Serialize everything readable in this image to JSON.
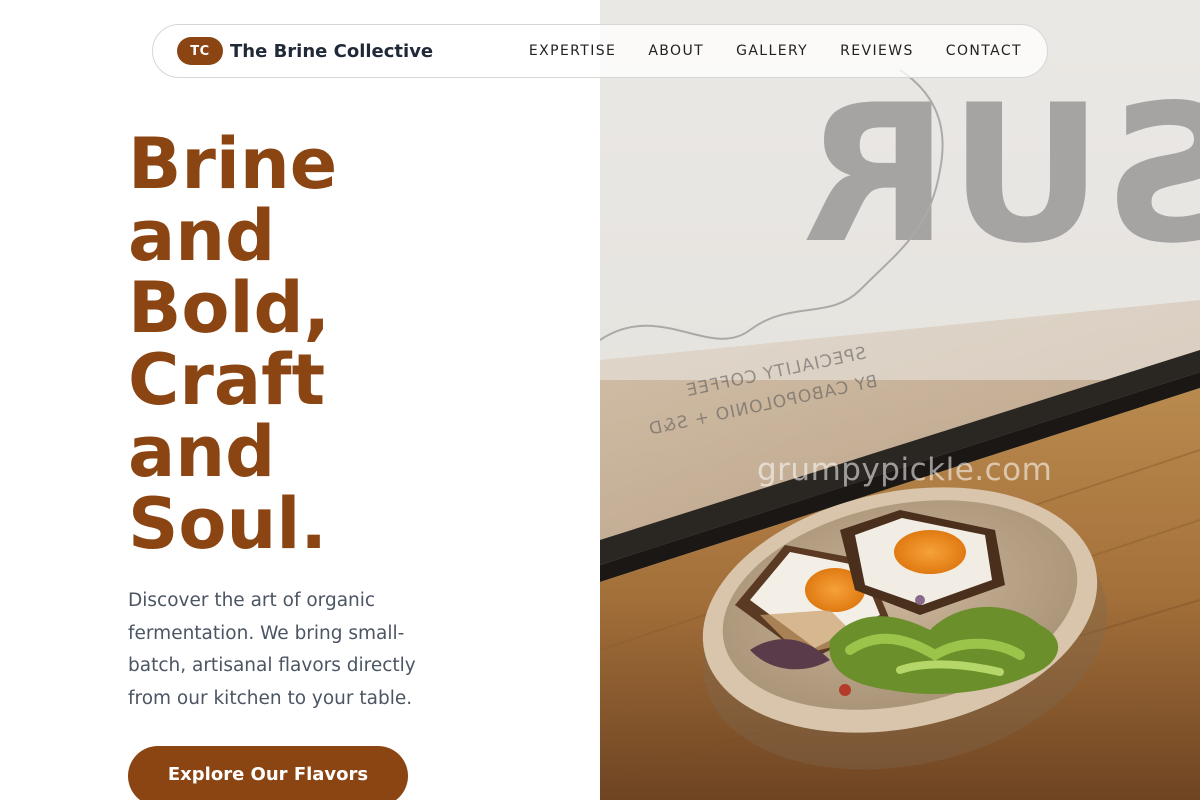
{
  "brand": {
    "initials": "TC",
    "name": "The Brine Collective"
  },
  "nav": {
    "links": [
      {
        "label": "EXPERTISE"
      },
      {
        "label": "ABOUT"
      },
      {
        "label": "GALLERY"
      },
      {
        "label": "REVIEWS"
      },
      {
        "label": "CONTACT"
      }
    ]
  },
  "hero": {
    "title_lines": [
      "Brine",
      "and",
      "Bold,",
      "Craft",
      "and",
      "Soul."
    ],
    "description": "Discover the art of organic fermentation. We bring small-batch, artisanal flavors directly from our kitchen to your table.",
    "cta_label": "Explore Our Flavors"
  },
  "photo": {
    "watermark": "grumpypickle.com",
    "window_sign": {
      "big_letters": "SUR",
      "line1": "SPECIALITY COFFEE",
      "line2": "BY CABOPOLONIO + S&D"
    }
  },
  "colors": {
    "accent": "#8b4513",
    "heading": "#8b4513",
    "body_text": "#4b5563",
    "nav_text": "#222222",
    "background": "#ffffff"
  }
}
